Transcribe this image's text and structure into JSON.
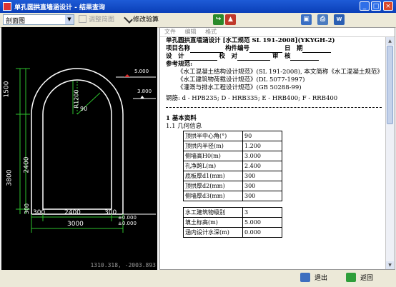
{
  "window": {
    "title": "单孔圆拱直墙涵设计 - 结果查询"
  },
  "toolbar": {
    "view_select": "剖面图",
    "adjust_label": "调整简图",
    "modify_label": "修改验算"
  },
  "report_menu": [
    "文件",
    "编辑",
    "格式"
  ],
  "drawing": {
    "coord": "1310.318, -2003.893",
    "dims": {
      "h1500": "1500",
      "h3800": "3800",
      "h2400": "2400",
      "h300a": "300",
      "w300l": "300",
      "w2400": "2400",
      "w300r": "300",
      "w3000": "3000",
      "r1200": "R1200",
      "lvl5000": "5.000",
      "lvl3800": "3.800",
      "lvl0": "±0.000",
      "lvl0b": "±0.000",
      "r90": "90"
    }
  },
  "report": {
    "title": "单孔圆拱直墙涵设计 [水工规范 SL 191-2008](YKYGH-2)",
    "line_project": "项目名称",
    "line_member": "构件编号",
    "line_date": "日　期",
    "line_design": "设　计",
    "line_check": "校　对",
    "line_review": "审　核",
    "refs_label": "参考规范:",
    "refs": [
      "《水工混凝土结构设计规范》(SL 191-2008), 本文简称《水工混凝土规范》",
      "《水工建筑物荷载设计规范》(DL 5077-1997)",
      "《灌溉与排水工程设计规范》(GB 50288-99)"
    ],
    "rebar": "钢筋: d - HPB235; D - HRB335; E - HRB400; F - RRB400",
    "sec1": "1 基本资料",
    "sec11": "1.1 几何信息",
    "geom_rows": [
      {
        "k": "顶拱半中心角(°)",
        "v": "90"
      },
      {
        "k": "顶拱内半径(m)",
        "v": "1.200"
      },
      {
        "k": "侧墙高H0(m)",
        "v": "3.000"
      },
      {
        "k": "孔净跨L(m)",
        "v": "2.400"
      },
      {
        "k": "底板厚d1(mm)",
        "v": "300"
      },
      {
        "k": "顶拱厚d2(mm)",
        "v": "300"
      },
      {
        "k": "侧墙厚d3(mm)",
        "v": "300"
      }
    ],
    "load_rows": [
      {
        "k": "水工建筑物级别",
        "v": "3"
      },
      {
        "k": "填土标高(m)",
        "v": "5.000"
      },
      {
        "k": "涵内设计水深(m)",
        "v": "0.000"
      }
    ]
  },
  "status": {
    "exit_label": "退出",
    "back_label": "返回"
  }
}
